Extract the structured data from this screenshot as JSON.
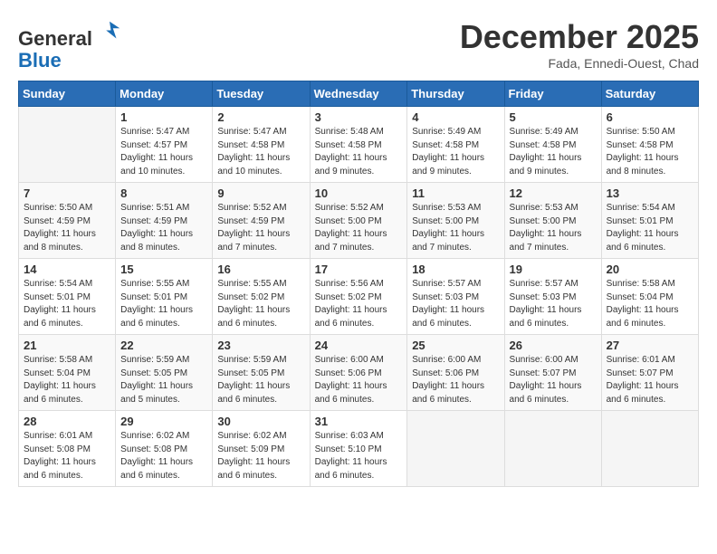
{
  "header": {
    "logo_line1": "General",
    "logo_line2": "Blue",
    "month_title": "December 2025",
    "location": "Fada, Ennedi-Ouest, Chad"
  },
  "days_of_week": [
    "Sunday",
    "Monday",
    "Tuesday",
    "Wednesday",
    "Thursday",
    "Friday",
    "Saturday"
  ],
  "weeks": [
    [
      {
        "day": "",
        "info": ""
      },
      {
        "day": "1",
        "info": "Sunrise: 5:47 AM\nSunset: 4:57 PM\nDaylight: 11 hours\nand 10 minutes."
      },
      {
        "day": "2",
        "info": "Sunrise: 5:47 AM\nSunset: 4:58 PM\nDaylight: 11 hours\nand 10 minutes."
      },
      {
        "day": "3",
        "info": "Sunrise: 5:48 AM\nSunset: 4:58 PM\nDaylight: 11 hours\nand 9 minutes."
      },
      {
        "day": "4",
        "info": "Sunrise: 5:49 AM\nSunset: 4:58 PM\nDaylight: 11 hours\nand 9 minutes."
      },
      {
        "day": "5",
        "info": "Sunrise: 5:49 AM\nSunset: 4:58 PM\nDaylight: 11 hours\nand 9 minutes."
      },
      {
        "day": "6",
        "info": "Sunrise: 5:50 AM\nSunset: 4:58 PM\nDaylight: 11 hours\nand 8 minutes."
      }
    ],
    [
      {
        "day": "7",
        "info": "Sunrise: 5:50 AM\nSunset: 4:59 PM\nDaylight: 11 hours\nand 8 minutes."
      },
      {
        "day": "8",
        "info": "Sunrise: 5:51 AM\nSunset: 4:59 PM\nDaylight: 11 hours\nand 8 minutes."
      },
      {
        "day": "9",
        "info": "Sunrise: 5:52 AM\nSunset: 4:59 PM\nDaylight: 11 hours\nand 7 minutes."
      },
      {
        "day": "10",
        "info": "Sunrise: 5:52 AM\nSunset: 5:00 PM\nDaylight: 11 hours\nand 7 minutes."
      },
      {
        "day": "11",
        "info": "Sunrise: 5:53 AM\nSunset: 5:00 PM\nDaylight: 11 hours\nand 7 minutes."
      },
      {
        "day": "12",
        "info": "Sunrise: 5:53 AM\nSunset: 5:00 PM\nDaylight: 11 hours\nand 7 minutes."
      },
      {
        "day": "13",
        "info": "Sunrise: 5:54 AM\nSunset: 5:01 PM\nDaylight: 11 hours\nand 6 minutes."
      }
    ],
    [
      {
        "day": "14",
        "info": "Sunrise: 5:54 AM\nSunset: 5:01 PM\nDaylight: 11 hours\nand 6 minutes."
      },
      {
        "day": "15",
        "info": "Sunrise: 5:55 AM\nSunset: 5:01 PM\nDaylight: 11 hours\nand 6 minutes."
      },
      {
        "day": "16",
        "info": "Sunrise: 5:55 AM\nSunset: 5:02 PM\nDaylight: 11 hours\nand 6 minutes."
      },
      {
        "day": "17",
        "info": "Sunrise: 5:56 AM\nSunset: 5:02 PM\nDaylight: 11 hours\nand 6 minutes."
      },
      {
        "day": "18",
        "info": "Sunrise: 5:57 AM\nSunset: 5:03 PM\nDaylight: 11 hours\nand 6 minutes."
      },
      {
        "day": "19",
        "info": "Sunrise: 5:57 AM\nSunset: 5:03 PM\nDaylight: 11 hours\nand 6 minutes."
      },
      {
        "day": "20",
        "info": "Sunrise: 5:58 AM\nSunset: 5:04 PM\nDaylight: 11 hours\nand 6 minutes."
      }
    ],
    [
      {
        "day": "21",
        "info": "Sunrise: 5:58 AM\nSunset: 5:04 PM\nDaylight: 11 hours\nand 6 minutes."
      },
      {
        "day": "22",
        "info": "Sunrise: 5:59 AM\nSunset: 5:05 PM\nDaylight: 11 hours\nand 5 minutes."
      },
      {
        "day": "23",
        "info": "Sunrise: 5:59 AM\nSunset: 5:05 PM\nDaylight: 11 hours\nand 6 minutes."
      },
      {
        "day": "24",
        "info": "Sunrise: 6:00 AM\nSunset: 5:06 PM\nDaylight: 11 hours\nand 6 minutes."
      },
      {
        "day": "25",
        "info": "Sunrise: 6:00 AM\nSunset: 5:06 PM\nDaylight: 11 hours\nand 6 minutes."
      },
      {
        "day": "26",
        "info": "Sunrise: 6:00 AM\nSunset: 5:07 PM\nDaylight: 11 hours\nand 6 minutes."
      },
      {
        "day": "27",
        "info": "Sunrise: 6:01 AM\nSunset: 5:07 PM\nDaylight: 11 hours\nand 6 minutes."
      }
    ],
    [
      {
        "day": "28",
        "info": "Sunrise: 6:01 AM\nSunset: 5:08 PM\nDaylight: 11 hours\nand 6 minutes."
      },
      {
        "day": "29",
        "info": "Sunrise: 6:02 AM\nSunset: 5:08 PM\nDaylight: 11 hours\nand 6 minutes."
      },
      {
        "day": "30",
        "info": "Sunrise: 6:02 AM\nSunset: 5:09 PM\nDaylight: 11 hours\nand 6 minutes."
      },
      {
        "day": "31",
        "info": "Sunrise: 6:03 AM\nSunset: 5:10 PM\nDaylight: 11 hours\nand 6 minutes."
      },
      {
        "day": "",
        "info": ""
      },
      {
        "day": "",
        "info": ""
      },
      {
        "day": "",
        "info": ""
      }
    ]
  ]
}
